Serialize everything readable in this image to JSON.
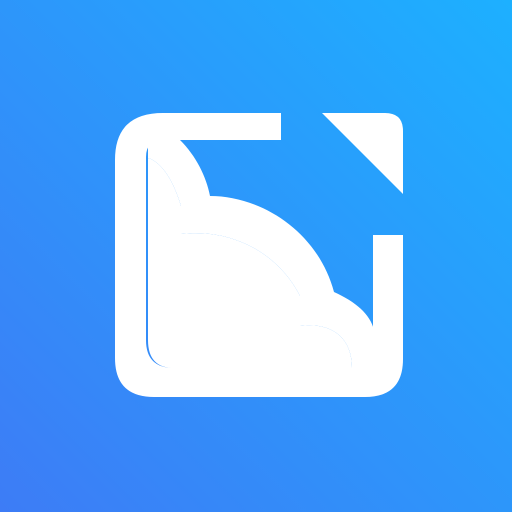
{
  "icon": {
    "name": "cloud-frame-app-icon",
    "glyph_color": "#FFFFFF",
    "background": {
      "gradient_start": "#3D7CF6",
      "gradient_end": "#1DB0FF"
    }
  }
}
